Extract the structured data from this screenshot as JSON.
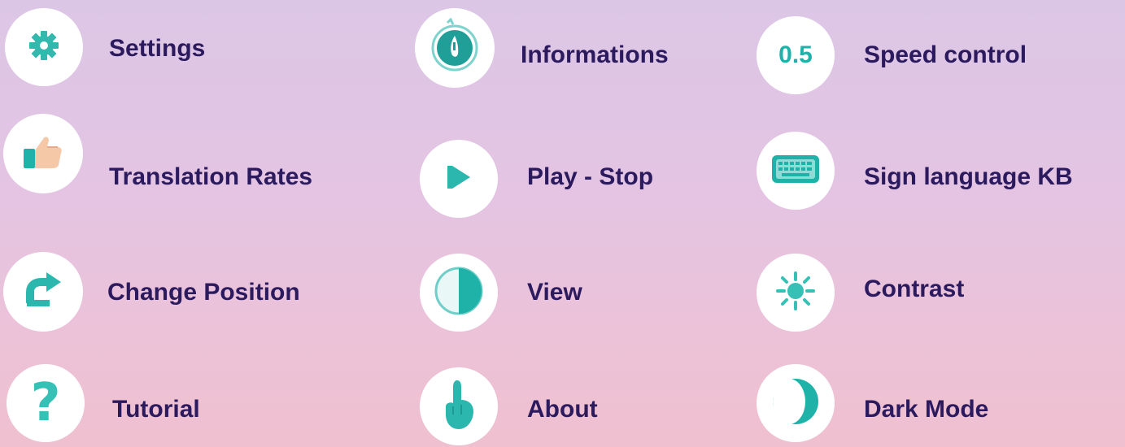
{
  "menu": {
    "items": [
      {
        "id": "settings",
        "label": "Settings",
        "icon": "gear-icon"
      },
      {
        "id": "informations",
        "label": "Informations",
        "icon": "info-hand-icon"
      },
      {
        "id": "speed-control",
        "label": "Speed control",
        "icon": "speed-icon",
        "value": "0.5"
      },
      {
        "id": "translation-rates",
        "label": "Translation Rates",
        "icon": "thumbs-up-icon"
      },
      {
        "id": "play-stop",
        "label": "Play - Stop",
        "icon": "play-icon"
      },
      {
        "id": "sign-language-kb",
        "label": "Sign language KB",
        "icon": "keyboard-icon"
      },
      {
        "id": "change-position",
        "label": "Change Position",
        "icon": "redo-arrow-icon"
      },
      {
        "id": "view",
        "label": "View",
        "icon": "half-circle-icon"
      },
      {
        "id": "contrast",
        "label": "Contrast",
        "icon": "sun-icon"
      },
      {
        "id": "tutorial",
        "label": "Tutorial",
        "icon": "question-icon"
      },
      {
        "id": "about",
        "label": "About",
        "icon": "pointing-hand-icon"
      },
      {
        "id": "dark-mode",
        "label": "Dark Mode",
        "icon": "moon-icon"
      }
    ]
  },
  "colors": {
    "accent": "#1fb2a9",
    "text": "#2c1a5e",
    "circle": "#ffffff"
  }
}
